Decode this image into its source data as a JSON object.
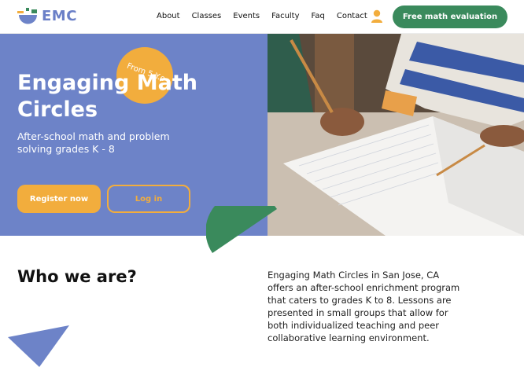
{
  "brand": {
    "name": "EMC"
  },
  "nav": {
    "items": [
      "About",
      "Classes",
      "Events",
      "Faculty",
      "Faq",
      "Contact"
    ]
  },
  "header": {
    "cta_label": "Free math evaluation"
  },
  "hero": {
    "title": "Engaging Math Circles",
    "badge": "From 5 Y.o",
    "subtitle": "After-school math and problem solving grades K - 8",
    "register_label": "Register now",
    "login_label": "Log in"
  },
  "about": {
    "title": "Who we are?",
    "text": "Engaging Math Circles in San Jose, CA offers an after-school enrichment program that caters to grades K to 8. Lessons are presented in small groups that allow for both individualized teaching and peer collaborative learning environment."
  },
  "colors": {
    "brand_blue": "#6d83c8",
    "brand_green": "#3a8a5c",
    "brand_orange": "#f2ad3d"
  },
  "icons": [
    "emc-logo-icon",
    "user-icon"
  ]
}
